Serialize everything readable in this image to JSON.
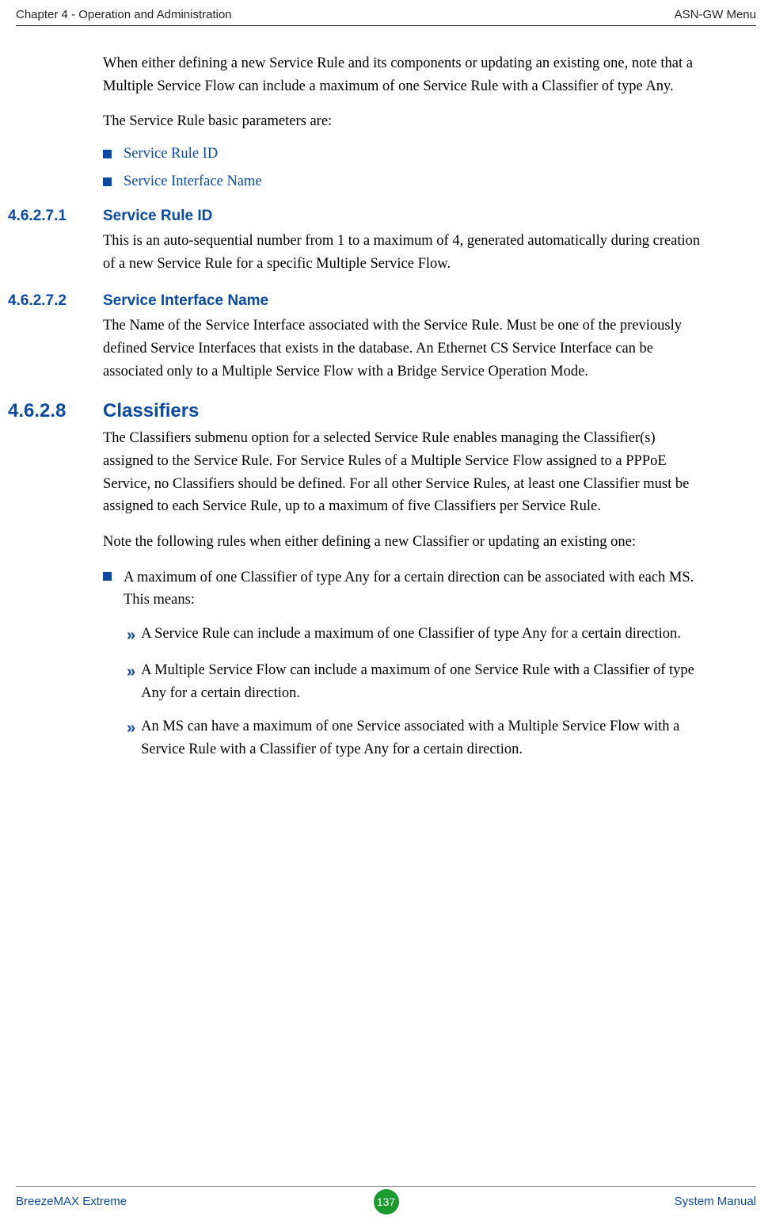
{
  "header": {
    "left": "Chapter 4 - Operation and Administration",
    "right": "ASN-GW Menu"
  },
  "intro": {
    "p1": "When either defining a new Service Rule and its components or updating an existing one, note that a Multiple Service Flow can include a maximum of one Service Rule with a Classifier of type Any.",
    "p2": "The Service Rule basic parameters are:"
  },
  "toc": {
    "i1": "Service Rule ID",
    "i2": "Service Interface Name"
  },
  "s1": {
    "num": "4.6.2.7.1",
    "title": "Service Rule ID",
    "body": "This is an auto-sequential number from 1 to a maximum of 4, generated automatically during creation of a new Service Rule for a specific Multiple Service Flow."
  },
  "s2": {
    "num": "4.6.2.7.2",
    "title": "Service Interface Name",
    "body": "The Name of the Service Interface associated with the Service Rule. Must be one of the previously defined Service Interfaces that exists in the database. An Ethernet CS Service Interface can be associated only to a Multiple Service Flow with a Bridge Service Operation Mode."
  },
  "s3": {
    "num": "4.6.2.8",
    "title": "Classifiers",
    "p1": "The Classifiers submenu option for a selected Service Rule enables managing the Classifier(s) assigned to the Service Rule. For Service Rules of a Multiple Service Flow assigned to a PPPoE Service, no Classifiers should be defined. For all other Service Rules, at least one Classifier must be assigned to each Service Rule, up to a maximum of five Classifiers per Service Rule.",
    "p2": "Note the following rules when either defining a new Classifier or updating an existing one:",
    "b1": "A maximum of one Classifier of type Any for a certain direction can be associated with each MS. This means:",
    "sub1": "A Service Rule can include a maximum of one Classifier of type Any for a certain direction.",
    "sub2": "A Multiple Service Flow can include a maximum of one Service Rule with a Classifier of type Any for a certain direction.",
    "sub3": "An MS can have a maximum of one Service associated with a Multiple Service Flow with a Service Rule with a Classifier of type Any for a certain direction."
  },
  "footer": {
    "left": "BreezeMAX Extreme",
    "page": "137",
    "right": "System Manual"
  }
}
